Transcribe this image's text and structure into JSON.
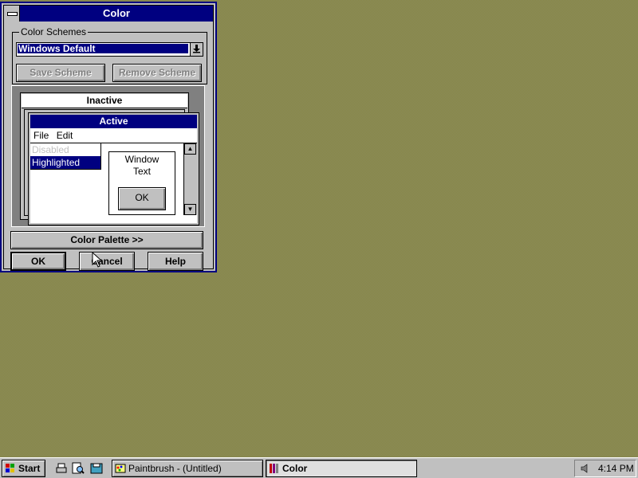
{
  "window": {
    "title": "Color"
  },
  "schemes": {
    "group_label": "Color Schemes",
    "selected": "Windows Default",
    "save_label": "Save Scheme",
    "remove_label": "Remove Scheme"
  },
  "sample": {
    "inactive_title": "Inactive",
    "active_title": "Active",
    "menu_file": "File",
    "menu_edit": "Edit",
    "menu_disabled": "Disabled",
    "menu_highlighted": "Highlighted",
    "window_text_line1": "Window",
    "window_text_line2": "Text",
    "ok_label": "OK"
  },
  "buttons": {
    "palette_label": "Color Palette >>",
    "ok_label": "OK",
    "cancel_label": "Cancel",
    "help_label": "Help"
  },
  "taskbar": {
    "start_label": "Start",
    "task1_label": "Paintbrush - (Untitled)",
    "task2_label": "Color",
    "clock": "4:14 PM"
  },
  "colors": {
    "title_active": "#000080",
    "face": "#c0c0c0",
    "desktop": "#808040"
  }
}
